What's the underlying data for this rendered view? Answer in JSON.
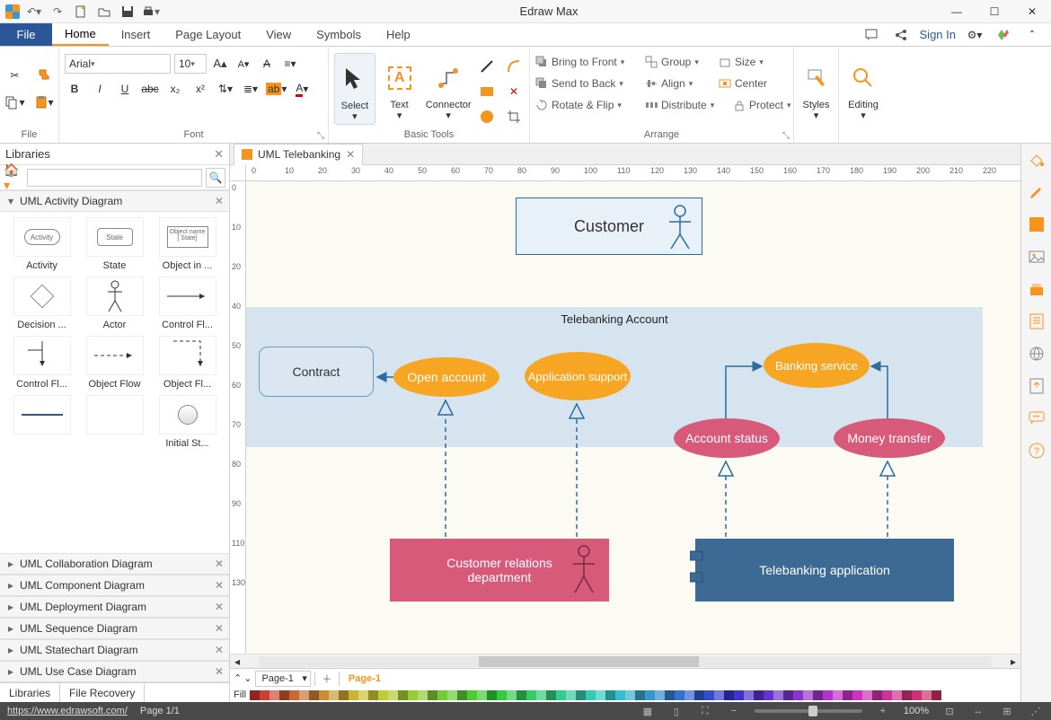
{
  "app_title": "Edraw Max",
  "tabs": {
    "file": "File",
    "home": "Home",
    "insert": "Insert",
    "page_layout": "Page Layout",
    "view": "View",
    "symbols": "Symbols",
    "help": "Help"
  },
  "signin": "Sign In",
  "ribbon": {
    "file_group": "File",
    "font_group": "Font",
    "font_name": "Arial",
    "font_size": "10",
    "basic_tools_group": "Basic Tools",
    "select": "Select",
    "text": "Text",
    "connector": "Connector",
    "arrange_group": "Arrange",
    "bring_front": "Bring to Front",
    "send_back": "Send to Back",
    "rotate_flip": "Rotate & Flip",
    "group": "Group",
    "align": "Align",
    "distribute": "Distribute",
    "size": "Size",
    "center": "Center",
    "protect": "Protect",
    "styles": "Styles",
    "editing": "Editing"
  },
  "libraries": {
    "title": "Libraries",
    "active_section": "UML Activity Diagram",
    "shapes": [
      "Activity",
      "State",
      "Object in ...",
      "Decision ...",
      "Actor",
      "Control Fl...",
      "Control Fl...",
      "Object Flow",
      "Object Fl...",
      "",
      "",
      "Initial St..."
    ],
    "collapsed": [
      "UML Collaboration Diagram",
      "UML Component Diagram",
      "UML Deployment Diagram",
      "UML Sequence Diagram",
      "UML Statechart Diagram",
      "UML Use Case Diagram"
    ],
    "bottom_tabs": {
      "libraries": "Libraries",
      "file_recovery": "File Recovery"
    }
  },
  "doc_tab": "UML Telebanking",
  "ruler_marks": [
    0,
    10,
    20,
    30,
    40,
    50,
    60,
    70,
    80,
    90,
    100,
    110,
    120,
    130,
    140,
    150,
    160,
    170,
    180,
    190,
    200,
    210,
    220
  ],
  "ruler_v_marks": [
    0,
    10,
    20,
    40,
    50,
    60,
    70,
    80,
    90,
    110,
    130
  ],
  "diagram": {
    "customer": "Customer",
    "region": "Telebanking Account",
    "contract": "Contract",
    "open_account": "Open account",
    "app_support": "Application support",
    "banking_service": "Banking service",
    "account_status": "Account status",
    "money_transfer": "Money transfer",
    "dept": "Customer relations department",
    "app": "Telebanking application"
  },
  "page_strip": {
    "page_name": "Page-1",
    "active": "Page-1",
    "fill": "Fill"
  },
  "statusbar": {
    "url": "https://www.edrawsoft.com/",
    "page": "Page 1/1",
    "zoom": "100%"
  }
}
